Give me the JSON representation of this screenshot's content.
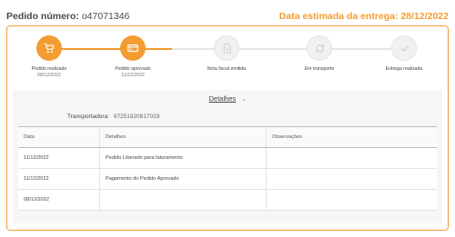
{
  "header": {
    "order_label": "Pedido número:",
    "order_number": "o47071346",
    "eta_label": "Data estimada da entrega:",
    "eta_date": "28/12/2022"
  },
  "colors": {
    "accent": "#f39c32",
    "inactive": "#f1f1f1"
  },
  "steps": [
    {
      "label": "Pedido realizado",
      "date": "08/12/2022",
      "status": "done",
      "icon": "cart-icon"
    },
    {
      "label": "Pedido aprovado",
      "date": "11/12/2022",
      "status": "done",
      "icon": "credit-card-icon"
    },
    {
      "label": "Nota fiscal emitida",
      "date": "",
      "status": "pending",
      "icon": "invoice-icon"
    },
    {
      "label": "Em transporte",
      "date": "",
      "status": "pending",
      "icon": "transport-icon"
    },
    {
      "label": "Entrega realizada",
      "date": "",
      "status": "pending",
      "icon": "check-icon"
    }
  ],
  "details": {
    "toggle_label": "Detalhes",
    "toggle_icon": "chevron-down-icon",
    "carrier_label": "Transportadora:",
    "carrier_value": "97251920817029"
  },
  "table": {
    "columns": [
      "Data",
      "Detalhes",
      "Observações"
    ],
    "rows": [
      [
        "11/12/2022",
        "Pedido Liberado para faturamento",
        ""
      ],
      [
        "11/12/2022",
        "Pagamento do Pedido Aprovado",
        ""
      ],
      [
        "08/12/2022",
        "",
        ""
      ]
    ]
  }
}
